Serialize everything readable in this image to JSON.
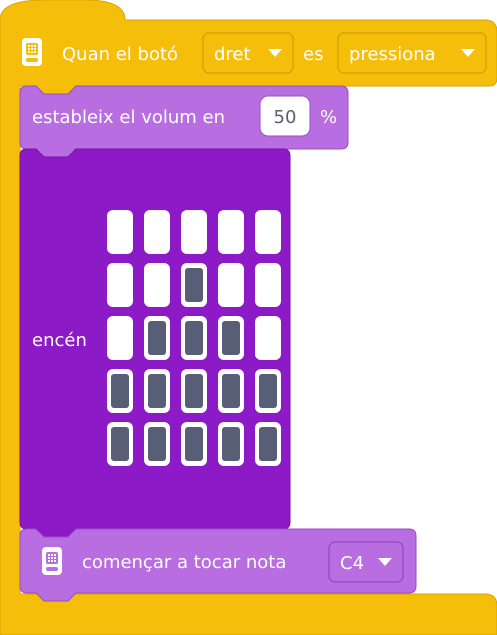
{
  "colors": {
    "event_fill": "#f5be0a",
    "event_stroke": "#d9a500",
    "sound_fill": "#b86de0",
    "sound_stroke": "#9a4ec6",
    "light_fill": "#8d1ac7",
    "light_stroke": "#7612a8",
    "led_on": "#575e75",
    "led_off": "#ffffff"
  },
  "hat_block": {
    "icon": "microbit-icon",
    "label": "Quan el botó",
    "button_dropdown": "dret",
    "connector": "es",
    "state_dropdown": "pressiona"
  },
  "volume_block": {
    "label": "estableix el volum en",
    "value": "50",
    "unit": "%"
  },
  "led_block": {
    "label": "encén",
    "matrix": [
      [
        0,
        0,
        0,
        0,
        0
      ],
      [
        0,
        0,
        1,
        0,
        0
      ],
      [
        0,
        1,
        1,
        1,
        0
      ],
      [
        1,
        1,
        1,
        1,
        1
      ],
      [
        1,
        1,
        1,
        1,
        1
      ]
    ]
  },
  "note_block": {
    "icon": "microbit-icon",
    "label": "començar a tocar nota",
    "note_dropdown": "C4"
  }
}
